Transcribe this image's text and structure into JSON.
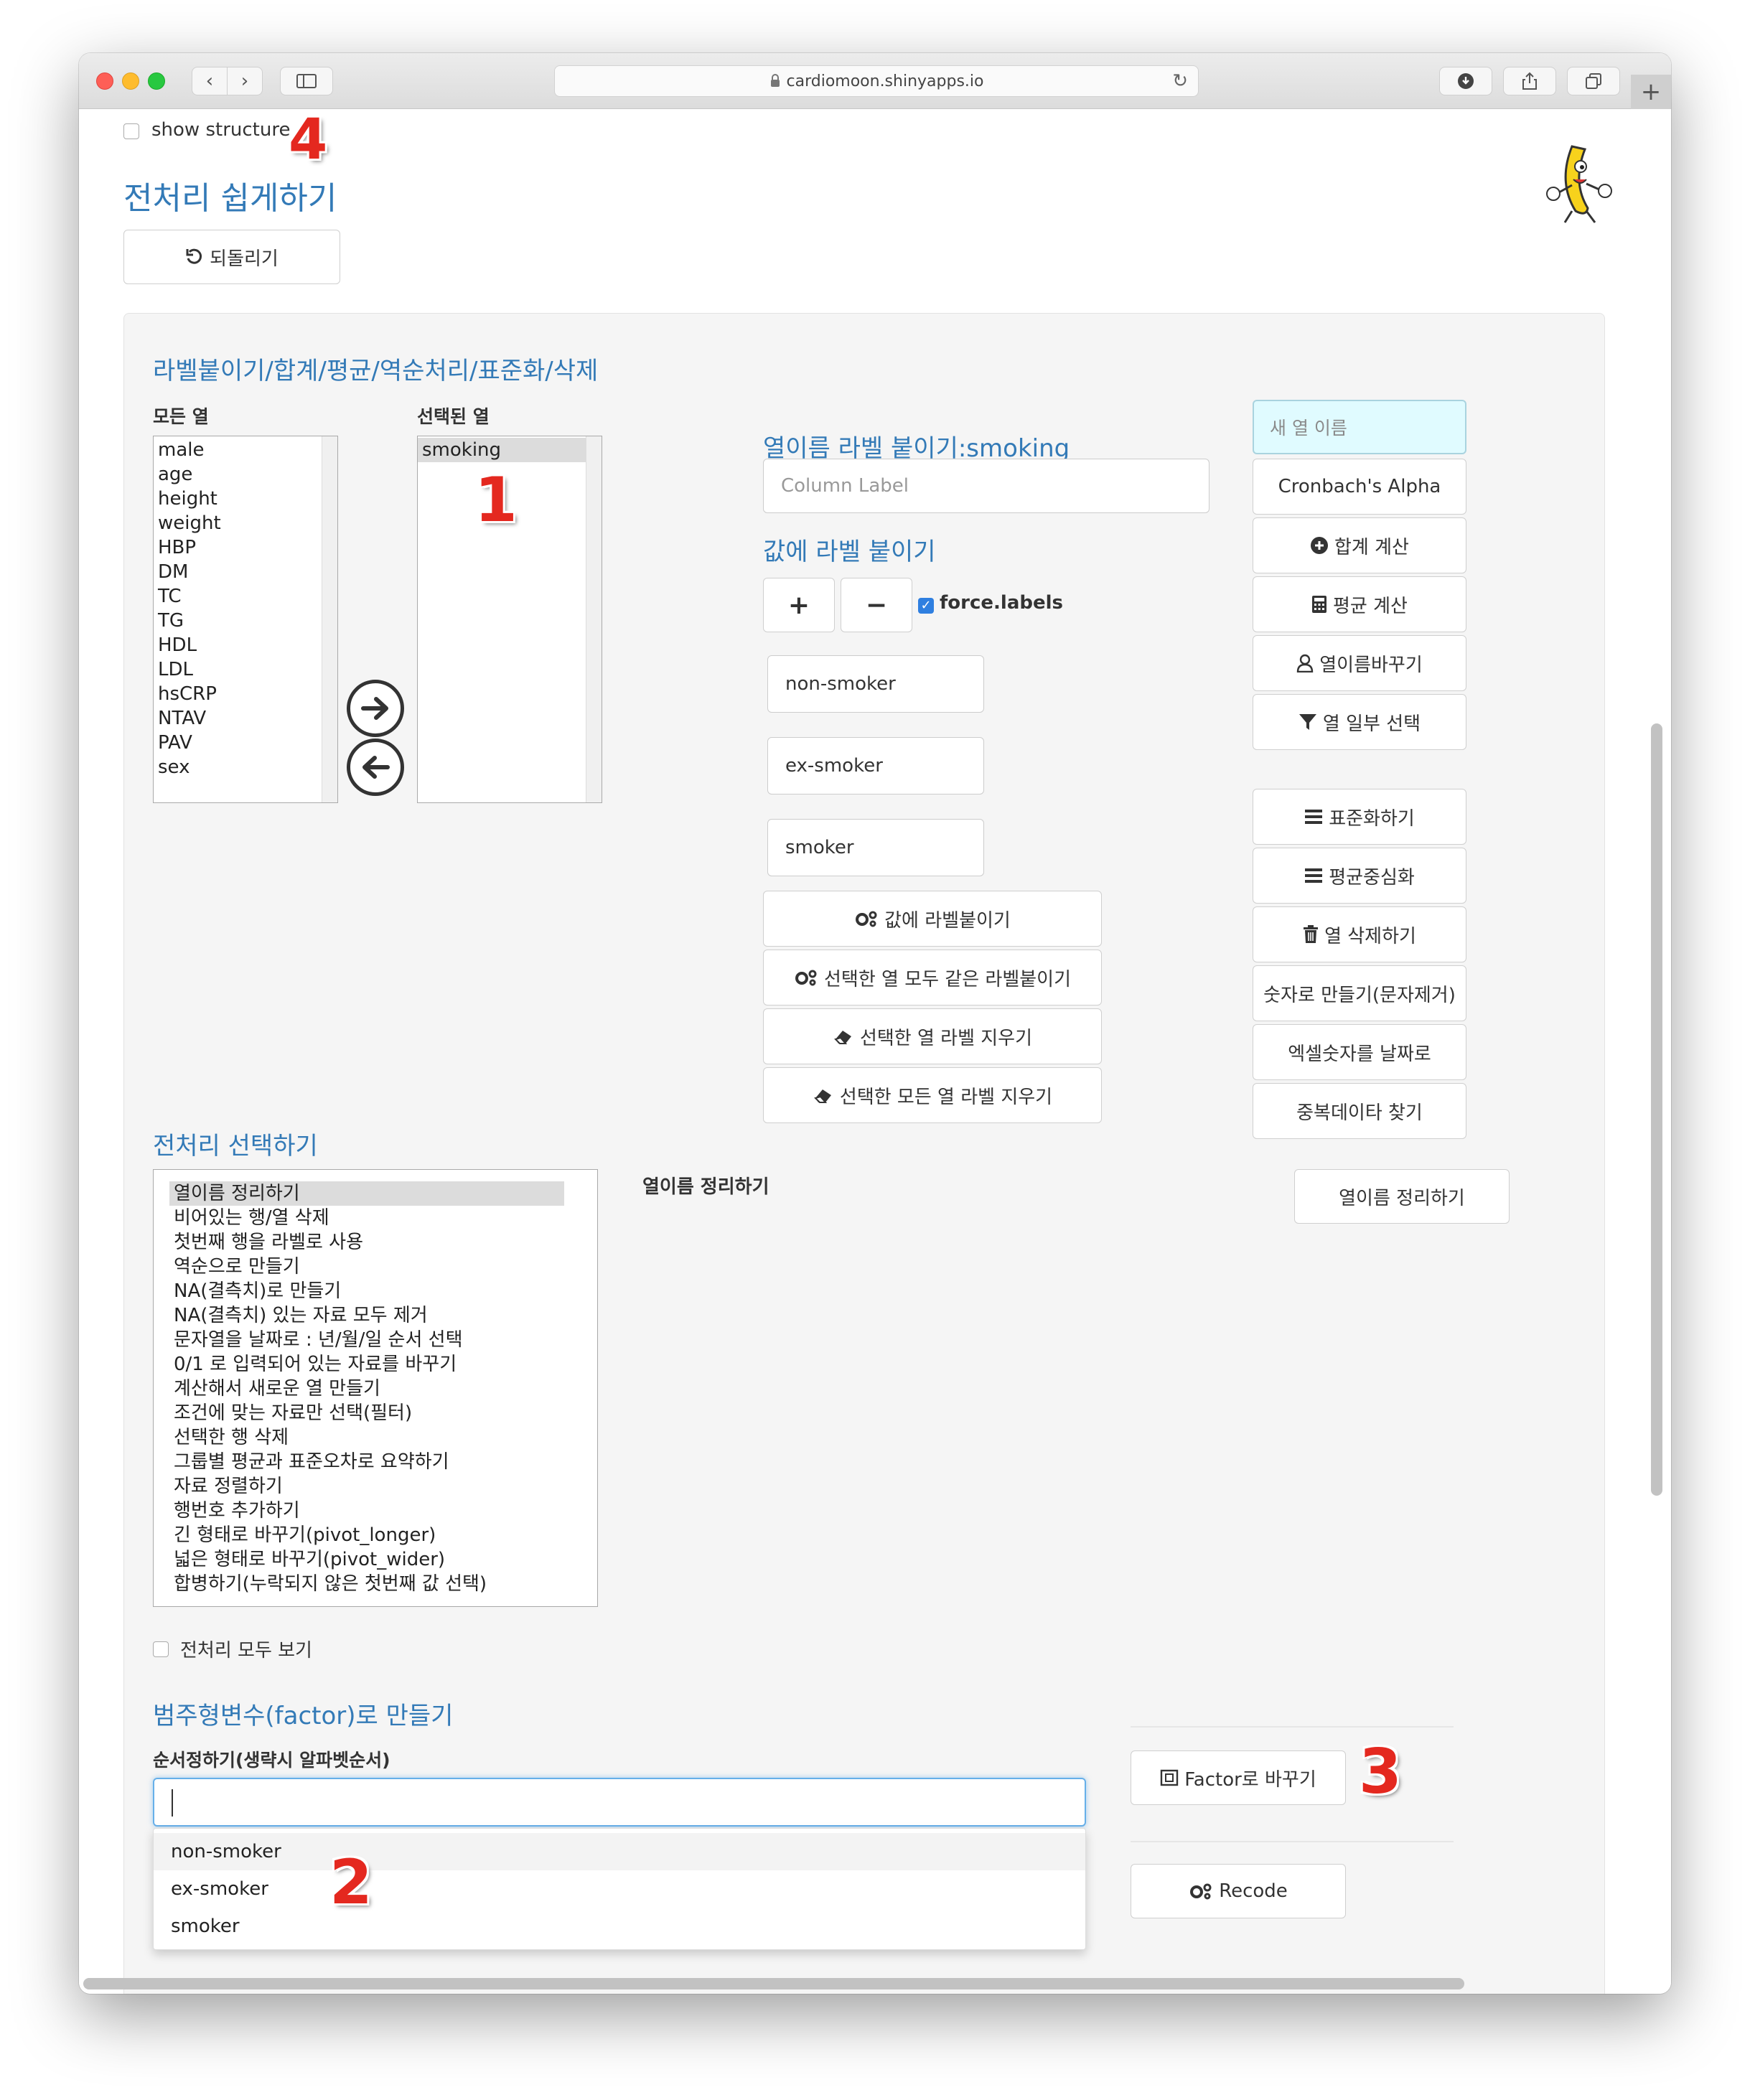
{
  "browser": {
    "url": "cardiomoon.shinyapps.io",
    "back_glyph": "‹",
    "forward_glyph": "›",
    "reload_glyph": "↻",
    "newtab_glyph": "+"
  },
  "page": {
    "show_structure_label": "show structure",
    "title": "전처리 쉽게하기",
    "undo_label": "되돌리기"
  },
  "label_panel": {
    "heading": "라벨붙이기/합계/평균/역순처리/표준화/삭제",
    "all_cols_label": "모든 열",
    "selected_cols_label": "선택된 열",
    "all_cols": [
      "male",
      "age",
      "height",
      "weight",
      "HBP",
      "DM",
      "TC",
      "TG",
      "HDL",
      "LDL",
      "hsCRP",
      "NTAV",
      "PAV",
      "sex"
    ],
    "selected_cols": [
      "smoking"
    ],
    "col_label_heading": "열이름 라벨 붙이기:smoking",
    "col_label_placeholder": "Column Label",
    "value_label_heading": "값에 라벨 붙이기",
    "plus_glyph": "+",
    "minus_glyph": "−",
    "force_labels": "force.labels",
    "value_labels": [
      "non-smoker",
      "ex-smoker",
      "smoker"
    ],
    "action_buttons": [
      "값에 라벨붙이기",
      "선택한 열 모두 같은 라벨붙이기",
      "선택한 열 라벨 지우기",
      "선택한 모든 열 라벨 지우기"
    ]
  },
  "right_panel": {
    "new_col_placeholder": "새 열 이름",
    "buttons_top": [
      "Cronbach's Alpha",
      "합계 계산",
      "평균 계산",
      "열이름바꾸기",
      "열 일부 선택"
    ],
    "buttons_bottom": [
      "표준화하기",
      "평균중심화",
      "열 삭제하기",
      "숫자로 만들기(문자제거)",
      "엑셀숫자를 날짜로",
      "중복데이타 찾기"
    ]
  },
  "preprocess": {
    "heading": "전처리 선택하기",
    "items": [
      "열이름 정리하기",
      "비어있는 행/열 삭제",
      "첫번째 행을 라벨로 사용",
      "역순으로 만들기",
      "NA(결측치)로 만들기",
      "NA(결측치) 있는 자료 모두 제거",
      "문자열을 날짜로 : 년/월/일 순서 선택",
      "0/1 로 입력되어 있는 자료를 바꾸기",
      "계산해서 새로운 열 만들기",
      "조건에 맞는 자료만 선택(필터)",
      "선택한 행 삭제",
      "그룹별 평균과 표준오차로 요약하기",
      "자료 정렬하기",
      "행번호 추가하기",
      "긴 형태로 바꾸기(pivot_longer)",
      "넓은 형태로 바꾸기(pivot_wider)",
      "합병하기(누락되지 않은 첫번째 값 선택)"
    ],
    "selected_title": "열이름 정리하기",
    "apply_button": "열이름 정리하기",
    "show_all_label": "전처리 모두 보기"
  },
  "factor": {
    "heading": "범주형변수(factor)로 만들기",
    "order_label": "순서정하기(생략시 알파벳순서)",
    "dropdown_options": [
      "non-smoker",
      "ex-smoker",
      "smoker"
    ],
    "factor_button": "Factor로 바꾸기",
    "recode_button": "Recode"
  },
  "annotations": [
    "1",
    "2",
    "3",
    "4"
  ],
  "colors": {
    "accent": "#337ab7",
    "annotation": "#e4281f",
    "focus": "#66afe9"
  }
}
